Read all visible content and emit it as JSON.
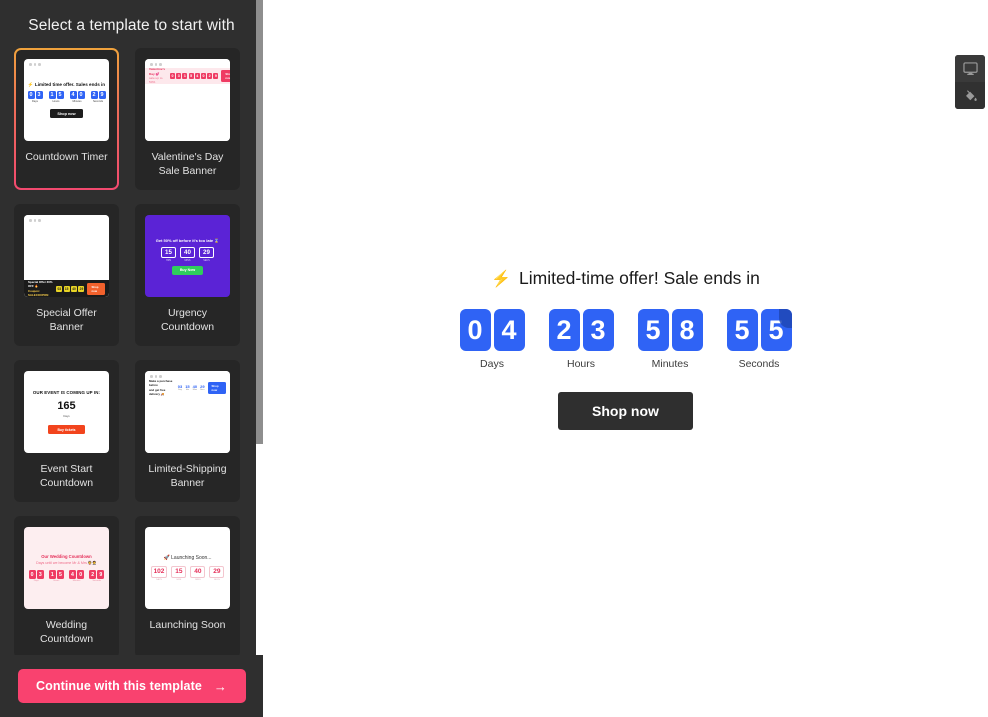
{
  "sidebar": {
    "title": "Select a template to start with",
    "continue_label": "Continue with this template",
    "continue_arrow": "→",
    "templates": [
      {
        "label": "Countdown Timer",
        "selected": true,
        "thumb": {
          "headline": "Limited time offer. Sales ends in",
          "bolt": "⚡",
          "button": "Shop now",
          "units": [
            {
              "label": "Days",
              "digits": [
                "0",
                "3"
              ]
            },
            {
              "label": "Hours",
              "digits": [
                "1",
                "5"
              ]
            },
            {
              "label": "Minutes",
              "digits": [
                "4",
                "0"
              ]
            },
            {
              "label": "Seconds",
              "digits": [
                "2",
                "9"
              ]
            }
          ]
        }
      },
      {
        "label": "Valentine's Day Sale Banner",
        "selected": false,
        "thumb": {
          "headline": "Valentine's Day 💕",
          "subline": "sale up to 50%",
          "button": "Shop now",
          "digits": [
            "0",
            "3",
            "1",
            "5",
            "4",
            "0",
            "2",
            "9"
          ]
        }
      },
      {
        "label": "Special Offer Banner",
        "selected": false,
        "thumb": {
          "headline": "Special Offer 30% OFF 🔥",
          "subline": "Coupon: SALECOUPON",
          "button": "Shop now",
          "digits": [
            "03",
            "15",
            "40",
            "29"
          ]
        }
      },
      {
        "label": "Urgency Countdown",
        "selected": false,
        "thumb": {
          "headline": "Get 50% off before it's too late ⌛",
          "button": "Buy Now",
          "units": [
            {
              "label": "HRS",
              "value": "15"
            },
            {
              "label": "MINS",
              "value": "40"
            },
            {
              "label": "SECS",
              "value": "29"
            }
          ]
        }
      },
      {
        "label": "Event Start Countdown",
        "selected": false,
        "thumb": {
          "headline": "OUR EVENT IS COMING UP IN:",
          "number": "165",
          "unit": "Days",
          "button": "Buy tickets"
        }
      },
      {
        "label": "Limited-Shipping Banner",
        "selected": false,
        "thumb": {
          "headline": "Make a purchase before",
          "subline": "and get free delivery 🚚",
          "button": "Shop now",
          "units": [
            {
              "label": "Day",
              "value": "03"
            },
            {
              "label": "Hrs",
              "value": "15"
            },
            {
              "label": "Mins",
              "value": "40"
            },
            {
              "label": "Secs",
              "value": "29"
            }
          ]
        }
      },
      {
        "label": "Wedding Countdown",
        "selected": false,
        "thumb": {
          "headline": "Our Wedding Countdown",
          "subline": "Days until we become Mr & Mrs 👰🤵",
          "units": [
            {
              "label": "Days",
              "digits": [
                "0",
                "3"
              ]
            },
            {
              "label": "Hours",
              "digits": [
                "1",
                "5"
              ]
            },
            {
              "label": "Minutes",
              "digits": [
                "4",
                "0"
              ]
            },
            {
              "label": "Seconds",
              "digits": [
                "2",
                "9"
              ]
            }
          ]
        }
      },
      {
        "label": "Launching Soon",
        "selected": false,
        "thumb": {
          "headline": "🚀 Launching Soon...",
          "units": [
            {
              "label": "DAYS",
              "value": "102"
            },
            {
              "label": "HRS",
              "value": "15"
            },
            {
              "label": "MINS",
              "value": "40"
            },
            {
              "label": "SECS",
              "value": "29"
            }
          ]
        }
      }
    ]
  },
  "preview": {
    "headline": "Limited-time offer! Sale ends in",
    "bolt_icon": "⚡",
    "button_label": "Shop now",
    "units": [
      {
        "label": "Days",
        "digits": [
          "0",
          "4"
        ],
        "flipping": false
      },
      {
        "label": "Hours",
        "digits": [
          "2",
          "3"
        ],
        "flipping": false
      },
      {
        "label": "Minutes",
        "digits": [
          "5",
          "8"
        ],
        "flipping": false
      },
      {
        "label": "Seconds",
        "digits": [
          "5",
          "5"
        ],
        "flipping": true
      }
    ]
  },
  "right_toolbar": {
    "items": [
      {
        "icon": "monitor-icon",
        "name": "device-preview-button"
      },
      {
        "icon": "paint-bucket-icon",
        "name": "fill-color-button"
      }
    ]
  },
  "colors": {
    "sidebar_bg": "#2f2f2f",
    "card_bg": "#262626",
    "accent_pink": "#f9426f",
    "accent_orange": "#f0a33c",
    "timer_blue": "#2f63f5",
    "button_dark": "#2f2f2f"
  }
}
